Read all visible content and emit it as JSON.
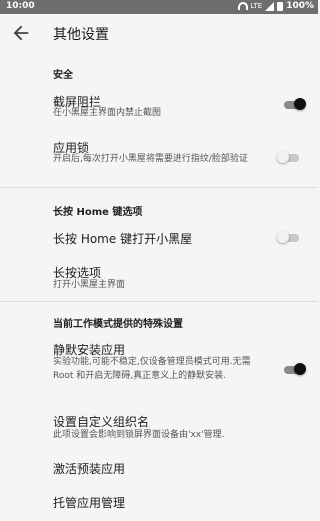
{
  "status_bar": {
    "time": "10:00",
    "network": "LTE",
    "battery": "100%"
  },
  "header": {
    "title": "其他设置"
  },
  "sections": {
    "security": {
      "title": "安全",
      "screenshot_block": {
        "title": "截屏阻拦",
        "subtitle": "在小黑屋主界面内禁止截图",
        "enabled": true
      },
      "app_lock": {
        "title": "应用锁",
        "subtitle": "开启后,每次打开小黑屋将需要进行指纹/脸部验证",
        "enabled": false
      }
    },
    "long_press": {
      "title": "长按 Home 键选项",
      "long_press_home": {
        "title": "长按 Home 键打开小黑屋",
        "enabled": false
      },
      "long_press_option": {
        "title": "长按选项",
        "subtitle": "打开小黑屋主界面"
      }
    },
    "special": {
      "title": "当前工作模式提供的特殊设置",
      "silent_install": {
        "title": "静默安装应用",
        "subtitle": "实验功能,可能不稳定,仅设备管理员模式可用.无需 Root 和开启无障碍,真正意义上的静默安装.",
        "enabled": true
      },
      "org_name": {
        "title": "设置自定义组织名",
        "subtitle": "此项设置会影响到锁屏界面设备由'xx'管理."
      },
      "activate_preinstalled": {
        "title": "激活预装应用"
      },
      "managed_apps": {
        "title": "托管应用管理"
      }
    }
  }
}
